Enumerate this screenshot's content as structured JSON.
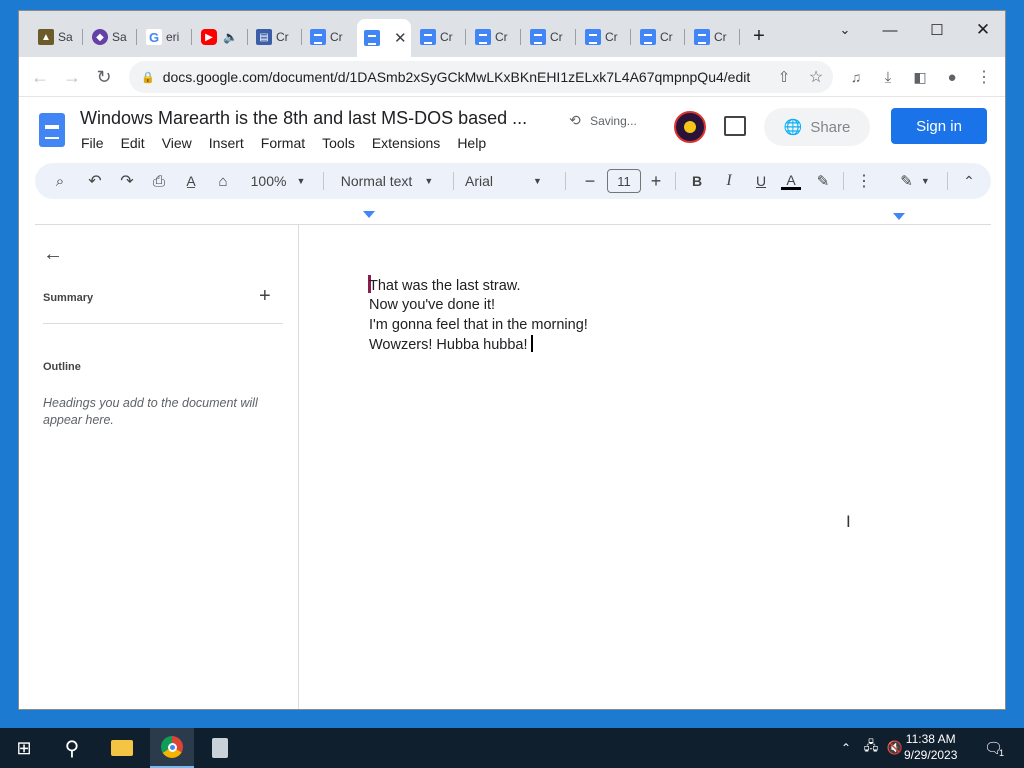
{
  "browser": {
    "tabs": [
      {
        "label": "Sa",
        "icon": "image-favicon",
        "color": "#6b5a2a"
      },
      {
        "label": "Sa",
        "icon": "twitch-favicon",
        "color": "#6441a5"
      },
      {
        "label": "eri",
        "icon": "google-favicon",
        "color": "#4285f4"
      },
      {
        "label": "",
        "icon": "youtube-favicon",
        "color": "#ff0000"
      },
      {
        "label": "Cr",
        "icon": "forms-favicon",
        "color": "#3a5ea8"
      },
      {
        "label": "Cr",
        "icon": "docs-favicon",
        "color": "#4285f4"
      },
      {
        "label": "",
        "icon": "docs-favicon",
        "color": "#4285f4"
      },
      {
        "label": "Cr",
        "icon": "docs-favicon",
        "color": "#4285f4"
      },
      {
        "label": "Cr",
        "icon": "docs-favicon",
        "color": "#4285f4"
      },
      {
        "label": "Cr",
        "icon": "docs-favicon",
        "color": "#4285f4"
      },
      {
        "label": "Cr",
        "icon": "docs-favicon",
        "color": "#4285f4"
      },
      {
        "label": "Cr",
        "icon": "docs-favicon",
        "color": "#4285f4"
      },
      {
        "label": "Cr",
        "icon": "docs-favicon",
        "color": "#4285f4"
      }
    ],
    "url": "docs.google.com/document/d/1DASmb2xSyGCkMwLKxBKnEHI1zELxk7L4A67qmpnpQu4/edit"
  },
  "docs": {
    "title": "Windows Marearth is the 8th and last MS-DOS based ...",
    "status": "Saving...",
    "share_label": "Share",
    "signin_label": "Sign in",
    "menu": [
      "File",
      "Edit",
      "View",
      "Insert",
      "Format",
      "Tools",
      "Extensions",
      "Help"
    ],
    "toolbar": {
      "zoom": "100%",
      "style": "Normal text",
      "font": "Arial",
      "font_size": "11"
    }
  },
  "sidebar": {
    "summary_label": "Summary",
    "outline_label": "Outline",
    "hint": "Headings you add to the document will appear here."
  },
  "document": {
    "lines": [
      "That was the last straw.",
      "Now you've done it!",
      "I'm gonna feel that in the morning!",
      "Wowzers! Hubba hubba!"
    ]
  },
  "taskbar": {
    "time": "11:38 AM",
    "date": "9/29/2023",
    "notification_count": "1"
  }
}
